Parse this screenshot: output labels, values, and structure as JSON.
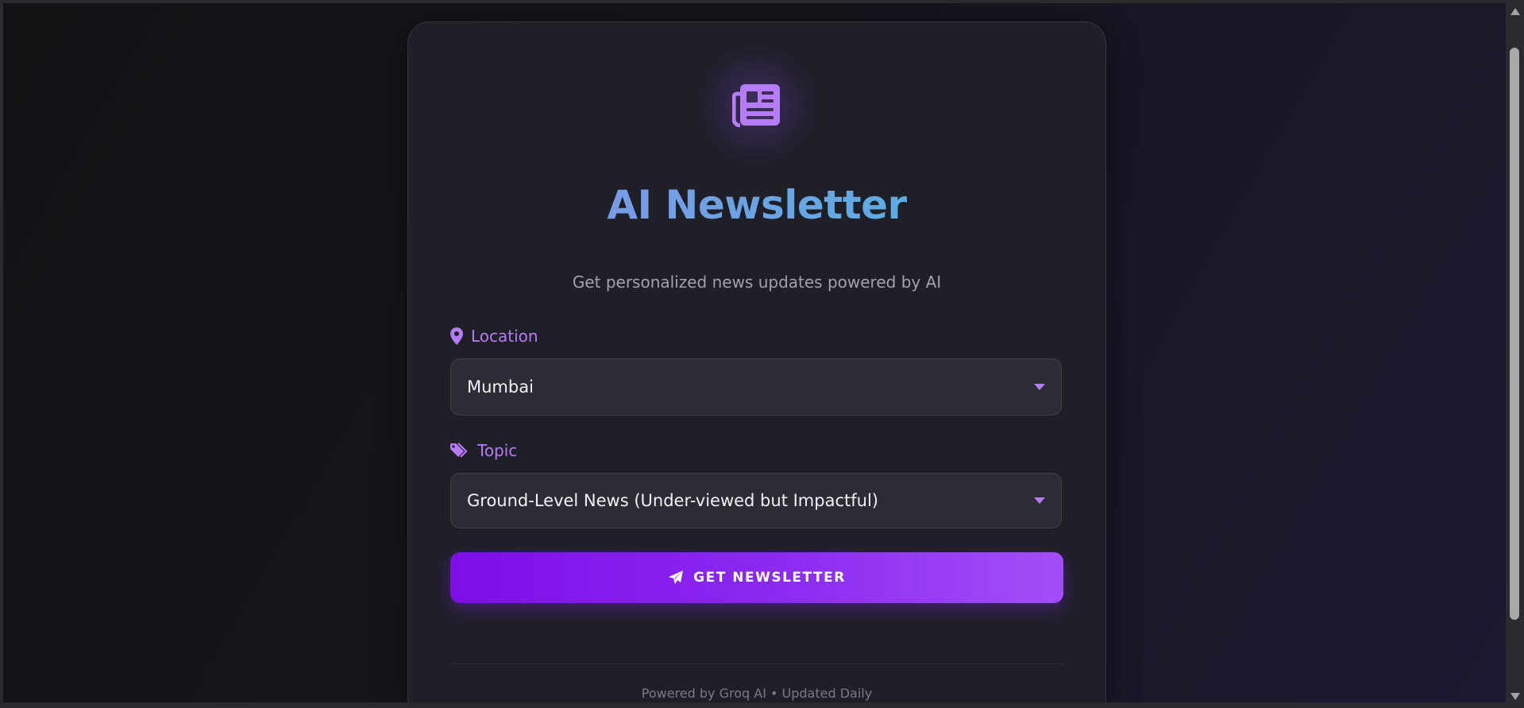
{
  "app": {
    "title": "AI Newsletter",
    "subtitle": "Get personalized news updates powered by AI",
    "logo_icon": "newspaper-icon"
  },
  "form": {
    "location": {
      "label": "Location",
      "icon": "map-pin-icon",
      "selected": "Mumbai"
    },
    "topic": {
      "label": "Topic",
      "icon": "tags-icon",
      "selected": "Ground-Level News (Under-viewed but Impactful)"
    },
    "submit": {
      "label": "GET NEWSLETTER",
      "icon": "paper-plane-icon"
    }
  },
  "footer": {
    "text": "Powered by Groq AI • Updated Daily"
  },
  "colors": {
    "accent": "#b57cf5",
    "button_start": "#7d0ee8",
    "button_end": "#a14ef7",
    "title_start": "#8a8fe8",
    "title_end": "#4bb8e0",
    "card_bg": "#1f1f28"
  }
}
